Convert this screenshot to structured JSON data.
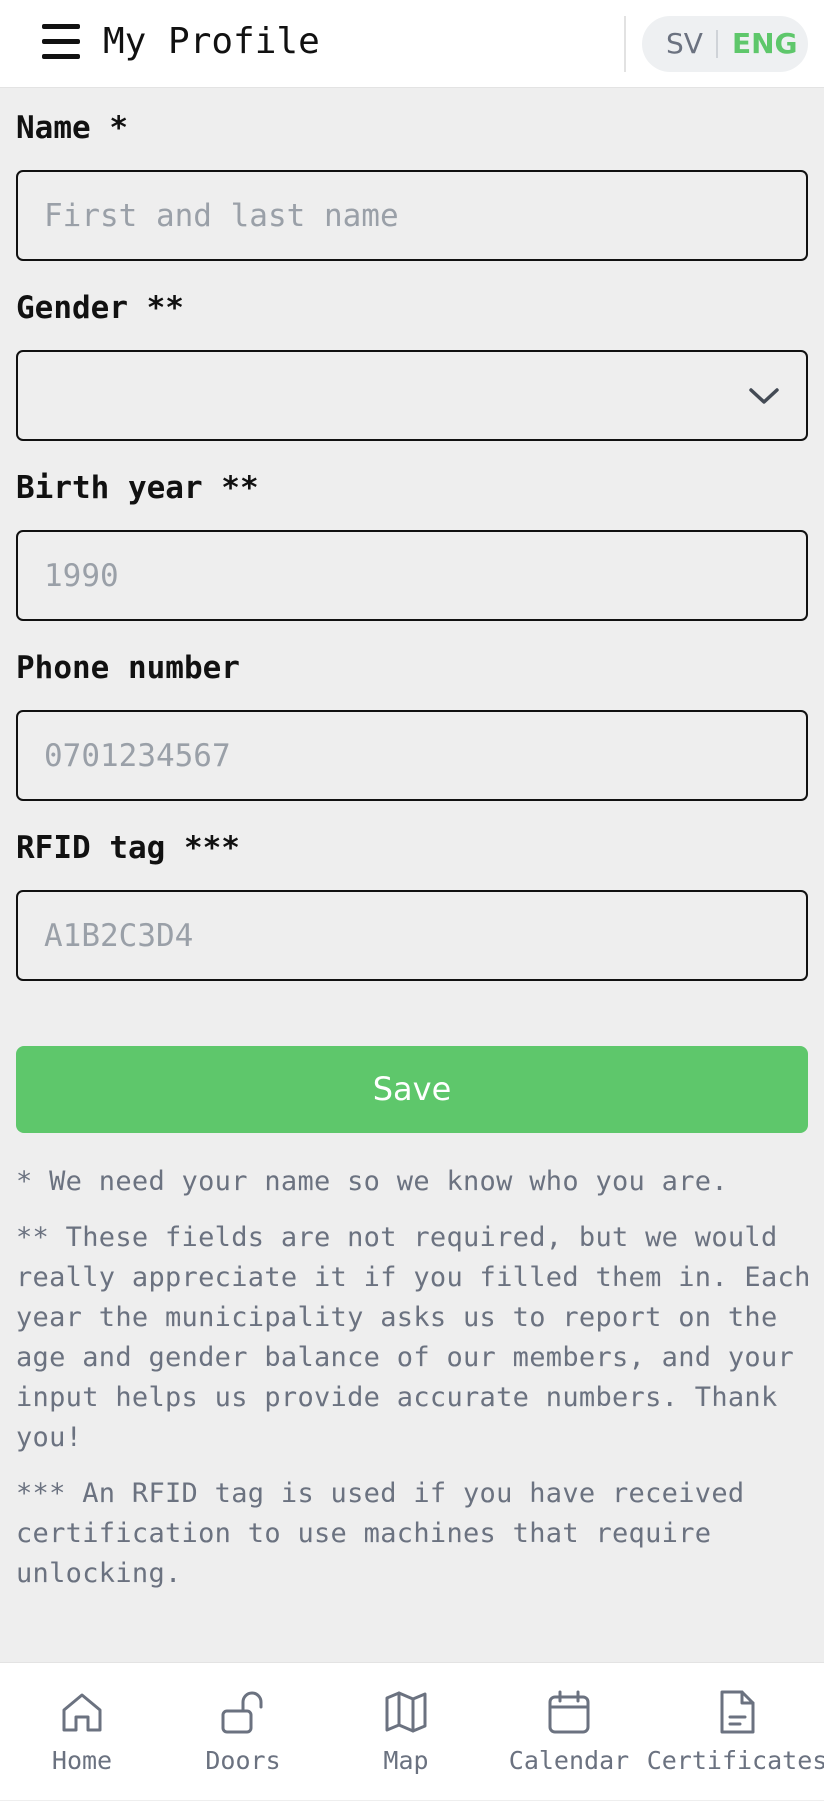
{
  "header": {
    "title": "My Profile",
    "menu_icon": "hamburger-menu-icon",
    "languages": {
      "sv": "SV",
      "eng": "ENG",
      "active": "ENG"
    }
  },
  "form": {
    "name": {
      "label": "Name *",
      "placeholder": "First and last name",
      "value": ""
    },
    "gender": {
      "label": "Gender **",
      "value": ""
    },
    "birth_year": {
      "label": "Birth year **",
      "placeholder": "1990",
      "value": ""
    },
    "phone": {
      "label": "Phone number",
      "placeholder": "0701234567",
      "value": ""
    },
    "rfid": {
      "label": "RFID tag ***",
      "placeholder": "A1B2C3D4",
      "value": ""
    },
    "save_label": "Save"
  },
  "notes": {
    "note1": "* We need your name so we know who you are.",
    "note2": "** These fields are not required, but we would really appreciate it if you filled them in. Each year the municipality asks us to report on the age and gender balance of our members, and your input helps us provide accurate numbers. Thank you!",
    "note3": "*** An RFID tag is used if you have received certification to use machines that require unlocking."
  },
  "bottom_nav": {
    "items": [
      {
        "label": "Home",
        "icon": "home-icon"
      },
      {
        "label": "Doors",
        "icon": "unlocked-padlock-icon"
      },
      {
        "label": "Map",
        "icon": "map-icon"
      },
      {
        "label": "Calendar",
        "icon": "calendar-icon"
      },
      {
        "label": "Certificates",
        "icon": "document-icon"
      }
    ]
  },
  "colors": {
    "accent": "#5ec76b",
    "background": "#eeeeee",
    "muted_text": "#6b7280"
  }
}
